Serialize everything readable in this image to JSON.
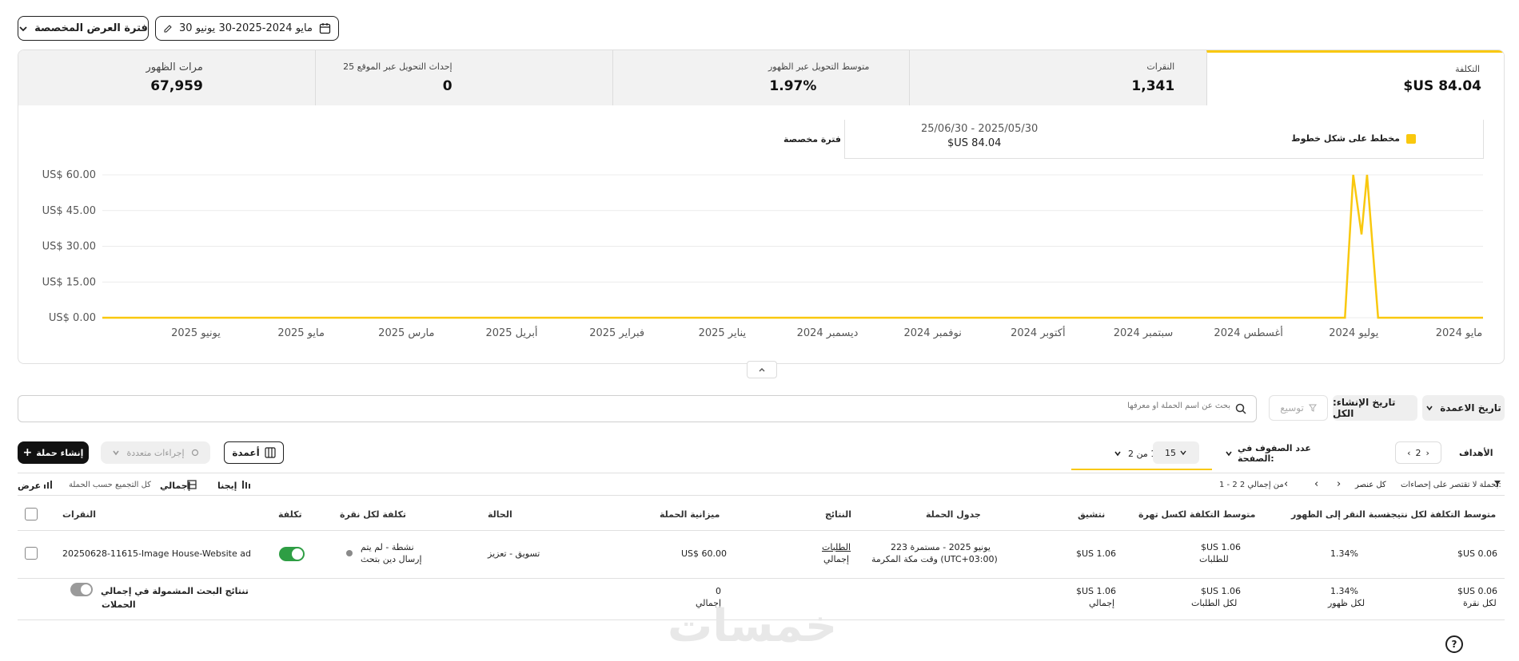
{
  "toolbar": {
    "view_period_label": "فترة العرض المخصصة",
    "date_range_label": "30 مايو 2024-2025-30 يونيو"
  },
  "metrics": [
    {
      "label": "التكلفة",
      "value": "$US 84.04",
      "active": true
    },
    {
      "label": "النقرات",
      "value": "1,341"
    },
    {
      "label": "متوسط التحويل عبر الظهور",
      "value": "1.97%"
    },
    {
      "label": "25 إحداث التحويل عبر الموقع",
      "value": "0"
    },
    {
      "label": "مرات الظهور",
      "value": "67,959"
    }
  ],
  "legend": {
    "series_label": "مخطط على شكل خطوط",
    "range": "25/06/30 - 2025/05/30",
    "total": "$US 84.04",
    "period_label": "فترة مخصصة",
    "series_color": "#f9c80e"
  },
  "chart_data": {
    "type": "line",
    "x_tick_labels": [
      "مايو 2024",
      "يوليو 2024",
      "أغسطس 2024",
      "سبتمبر 2024",
      "أكتوبر 2024",
      "نوفمبر 2024",
      "ديسمبر 2024",
      "يناير 2025",
      "فبراير 2025",
      "أبريل 2025",
      "مارس 2025",
      "مايو 2025",
      "يونيو 2025"
    ],
    "y_tick_labels": [
      "US$ 60.00",
      "US$ 45.00",
      "US$ 30.00",
      "US$ 15.00",
      "US$ 0.00"
    ],
    "ylim": [
      0,
      60
    ],
    "x": [
      0,
      100,
      7.6,
      8.4,
      8.8,
      9.4,
      10.0,
      10.6,
      11.0,
      14
    ],
    "values": [
      0,
      0,
      0,
      60,
      35,
      60,
      0,
      0,
      0,
      0
    ],
    "series_color": "#f9c80e",
    "grid": true
  },
  "filters": {
    "columns_date_label": "تاريخ الاعمدة",
    "creation_date_label": "تاريخ الإنشاء: الكل",
    "expand_label": "توسيع",
    "search_placeholder": "بحث عن اسم الحملة أو معرفها"
  },
  "actions": {
    "create_campaign": "إنشاء حملة",
    "multiple_actions": "إجراءات متعددة",
    "columns": "أعمدة",
    "goal": "الأهداف",
    "rows_per_page_label": "عدد الصفوف في الصفحة:",
    "rows_per_page_value": "15",
    "page_info": "عدد 1 من 2",
    "page_nav": "2"
  },
  "subbar": {
    "filter_label": "بحملة لا تقتصر على إحصاءات:",
    "filter_action": "كل عنصر",
    "range_info": "1 - 2 من إجمالي 2",
    "view_label": "عرض",
    "group_label": "كل التجميع حسب الحملة",
    "total_label": "إجمالي",
    "details_label": "إيجنا"
  },
  "table": {
    "headers": {
      "name": "النقرات",
      "cost": "تكلفة",
      "cpc": "تكلفة لكل نقرة",
      "status": "الحالة",
      "budget": "ميزانية الحملة",
      "results": "النتائج",
      "schedule": "جدول الحملة",
      "impressions": "نتشيق",
      "avg_cost": "متوسط التكلفة لكسل تهرة",
      "ctr": "نسبة النقر إلى الظهور",
      "cost_per_result": "متوسط التكلفة لكل نتيجة"
    },
    "rows": [
      {
        "name": "20250628-11615-Image House-Website ad",
        "status_line1": "نشطة - لم يتم",
        "status_line2": "إرسال دين بتحث",
        "type": "تسويق - تعزيز",
        "budget": "US$ 60.00",
        "results_link": "الطلبات",
        "results_sub": "إجمالي",
        "schedule_line1": "223 يونيو 2025 - مستمرة",
        "schedule_line2": "وقت مكة المكرمة (UTC+03:00)",
        "impressions": "$US 1.06",
        "avg_cost": "$US 1.06",
        "avg_cost_sub": "للطلبات",
        "ctr": "1.34%",
        "cost_per_result": "$US 0.06"
      }
    ],
    "totals": {
      "label_line1": "تنتائج البحث المشمولة في إجمالي",
      "label_line2": "الحملات",
      "budget": "0",
      "budget_sub": "إجمالي",
      "impressions": "$US 1.06",
      "impressions_sub": "إجمالي",
      "avg_cost": "$US 1.06",
      "avg_cost_sub": "لكل الطلبات",
      "ctr": "1.34%",
      "ctr_sub": "لكل ظهور",
      "cost_per_result": "$US 0.06",
      "cost_per_result_sub": "لكل نقرة"
    }
  },
  "watermark": "خمسات",
  "colors": {
    "accent": "#f9c80e",
    "toggle_on": "#2e9e44",
    "ink": "#1f1f1f"
  }
}
